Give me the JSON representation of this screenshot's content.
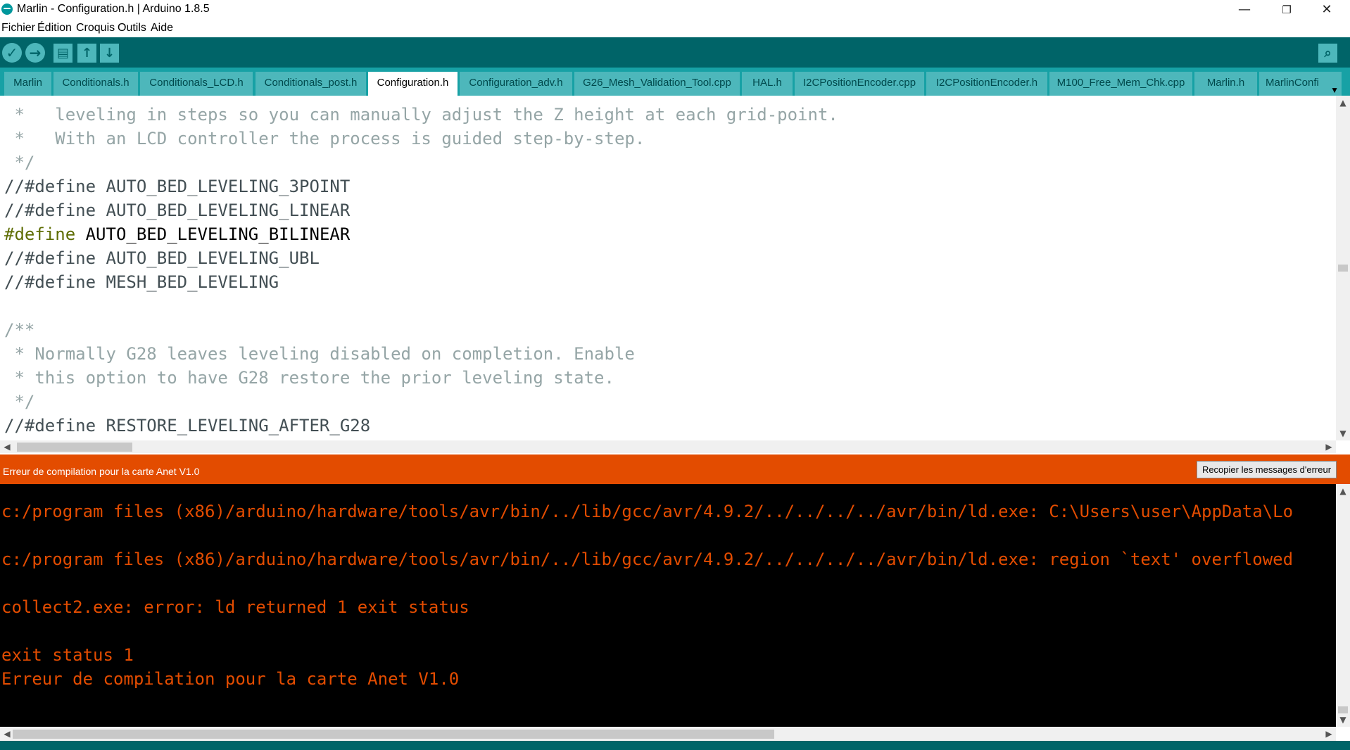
{
  "window": {
    "title": "Marlin - Configuration.h | Arduino 1.8.5",
    "minimize": "—",
    "restore": "❐",
    "close": "✕"
  },
  "menu": [
    "Fichier",
    "Édition",
    "Croquis",
    "Outils",
    "Aide"
  ],
  "toolbar": {
    "verify_icon": "✓",
    "upload_icon": "→",
    "new_icon": "▤",
    "open_icon": "↑",
    "save_icon": "↓",
    "serial_icon": "⌕"
  },
  "tabs": [
    "Marlin",
    "Conditionals.h",
    "Conditionals_LCD.h",
    "Conditionals_post.h",
    "Configuration.h",
    "Configuration_adv.h",
    "G26_Mesh_Validation_Tool.cpp",
    "HAL.h",
    "I2CPositionEncoder.cpp",
    "I2CPositionEncoder.h",
    "M100_Free_Mem_Chk.cpp",
    "Marlin.h",
    "MarlinConfi"
  ],
  "selected_tab": "Configuration.h",
  "editor": {
    "line1": " *   leveling in steps so you can manually adjust the Z height at each grid-point.",
    "line2": " *   With an LCD controller the process is guided step-by-step.",
    "line3": " */",
    "line4": "//#define AUTO_BED_LEVELING_3POINT",
    "line5": "//#define AUTO_BED_LEVELING_LINEAR",
    "line6_kw": "#define",
    "line6_rest": " AUTO_BED_LEVELING_BILINEAR",
    "line7": "//#define AUTO_BED_LEVELING_UBL",
    "line8": "//#define MESH_BED_LEVELING",
    "line9": "/**",
    "line10": " * Normally G28 leaves leveling disabled on completion. Enable",
    "line11": " * this option to have G28 restore the prior leveling state.",
    "line12": " */",
    "line13": "//#define RESTORE_LEVELING_AFTER_G28"
  },
  "status": {
    "message": "Erreur de compilation pour la carte Anet V1.0",
    "copy_button": "Recopier les messages d'erreur"
  },
  "console": {
    "line1": "c:/program files (x86)/arduino/hardware/tools/avr/bin/../lib/gcc/avr/4.9.2/../../../../avr/bin/ld.exe: C:\\Users\\user\\AppData\\Lo",
    "line2": "c:/program files (x86)/arduino/hardware/tools/avr/bin/../lib/gcc/avr/4.9.2/../../../../avr/bin/ld.exe: region `text' overflowed",
    "line3": "collect2.exe: error: ld returned 1 exit status",
    "line4": "exit status 1",
    "line5": "Erreur de compilation pour la carte Anet V1.0"
  },
  "colors": {
    "toolbar": "#006468",
    "tabbar": "#17a1a5",
    "tab": "#4db7bb",
    "error": "#e34c00"
  }
}
